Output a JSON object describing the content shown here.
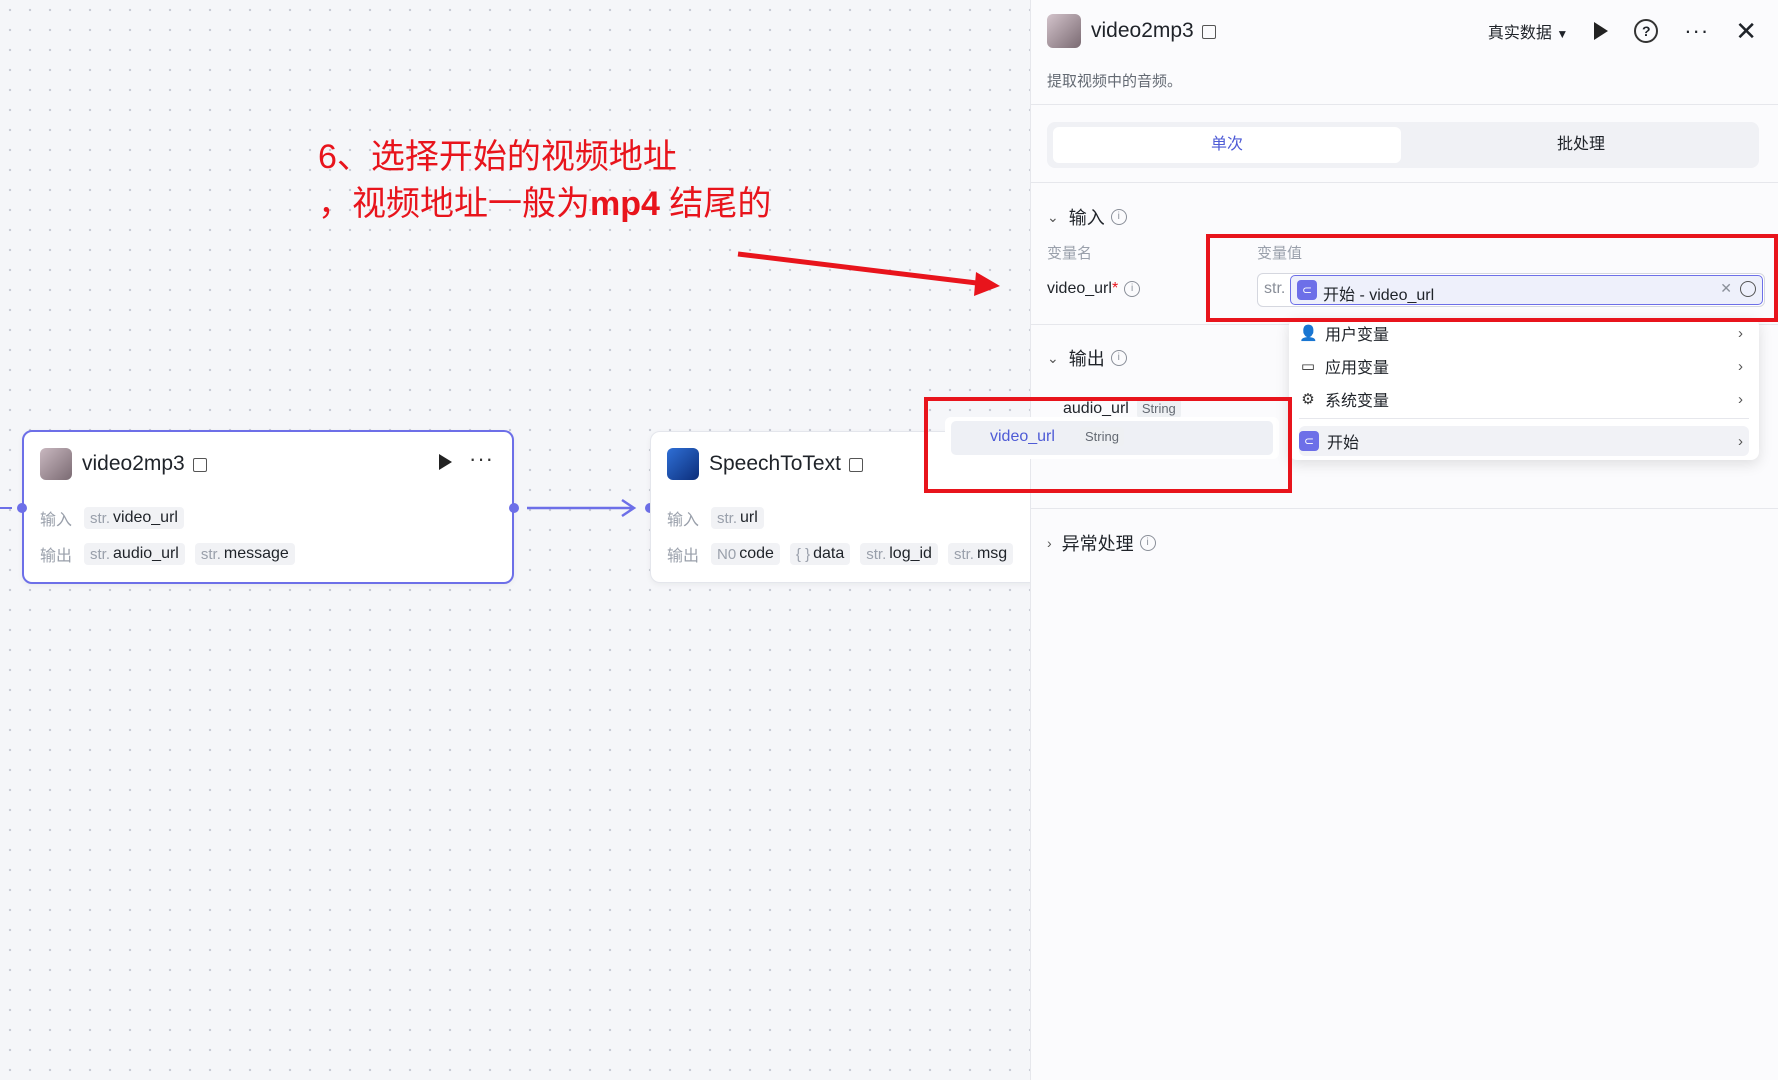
{
  "canvas": {
    "annotation": {
      "line1": "6、选择开始的视频地址",
      "line2_prefix": "，视频地址一般为",
      "line2_bold": "mp4",
      "line2_suffix": " 结尾的"
    },
    "node_video2mp3": {
      "title": "video2mp3",
      "input_label": "输入",
      "output_label": "输出",
      "inputs": [
        {
          "type": "str.",
          "name": "video_url"
        }
      ],
      "outputs": [
        {
          "type": "str.",
          "name": "audio_url"
        },
        {
          "type": "str.",
          "name": "message"
        }
      ]
    },
    "node_speech": {
      "title": "SpeechToText",
      "input_label": "输入",
      "output_label": "输出",
      "inputs": [
        {
          "type": "str.",
          "name": "url"
        }
      ],
      "outputs": [
        {
          "type": "N0",
          "name": "code"
        },
        {
          "type": "{ }",
          "name": "data"
        },
        {
          "type": "str.",
          "name": "log_id"
        },
        {
          "type": "str.",
          "name": "msg"
        }
      ]
    }
  },
  "panel": {
    "title": "video2mp3",
    "subtitle": "提取视频中的音频。",
    "data_mode": "真实数据",
    "tabs": {
      "single": "单次",
      "batch": "批处理"
    },
    "input_section": "输入",
    "col_name": "变量名",
    "col_value": "变量值",
    "var_name": "video_url",
    "var_required": "*",
    "value_type": "str.",
    "value_text": "开始 - video_url",
    "output_section": "输出",
    "outputs": [
      {
        "name": "audio_url",
        "type": "String"
      }
    ],
    "exception_section": "异常处理"
  },
  "dropdown": {
    "items": [
      {
        "label": "用户变量",
        "icon": "user-icon"
      },
      {
        "label": "应用变量",
        "icon": "folder-icon"
      },
      {
        "label": "系统变量",
        "icon": "gear-icon"
      }
    ],
    "start_label": "开始",
    "sub_item": {
      "name": "video_url",
      "type": "String"
    }
  },
  "colors": {
    "accent": "#6d6fe8",
    "annotation": "#e8141c"
  }
}
